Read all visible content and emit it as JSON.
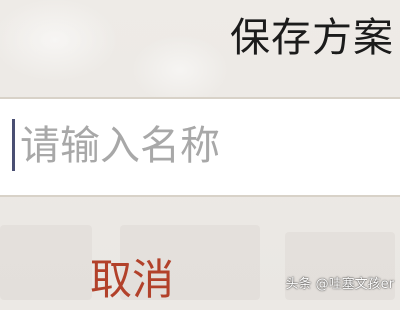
{
  "dialog": {
    "title": "保存方案",
    "name_input": {
      "placeholder": "请输入名称",
      "value": ""
    },
    "cancel_label": "取消"
  },
  "watermark": "头条 @哇塞文孩er",
  "colors": {
    "title": "#1b1b1b",
    "placeholder": "#a8a8a8",
    "caret": "#4a4f73",
    "cancel": "#b2412a",
    "input_border": "#d8d2c8"
  }
}
